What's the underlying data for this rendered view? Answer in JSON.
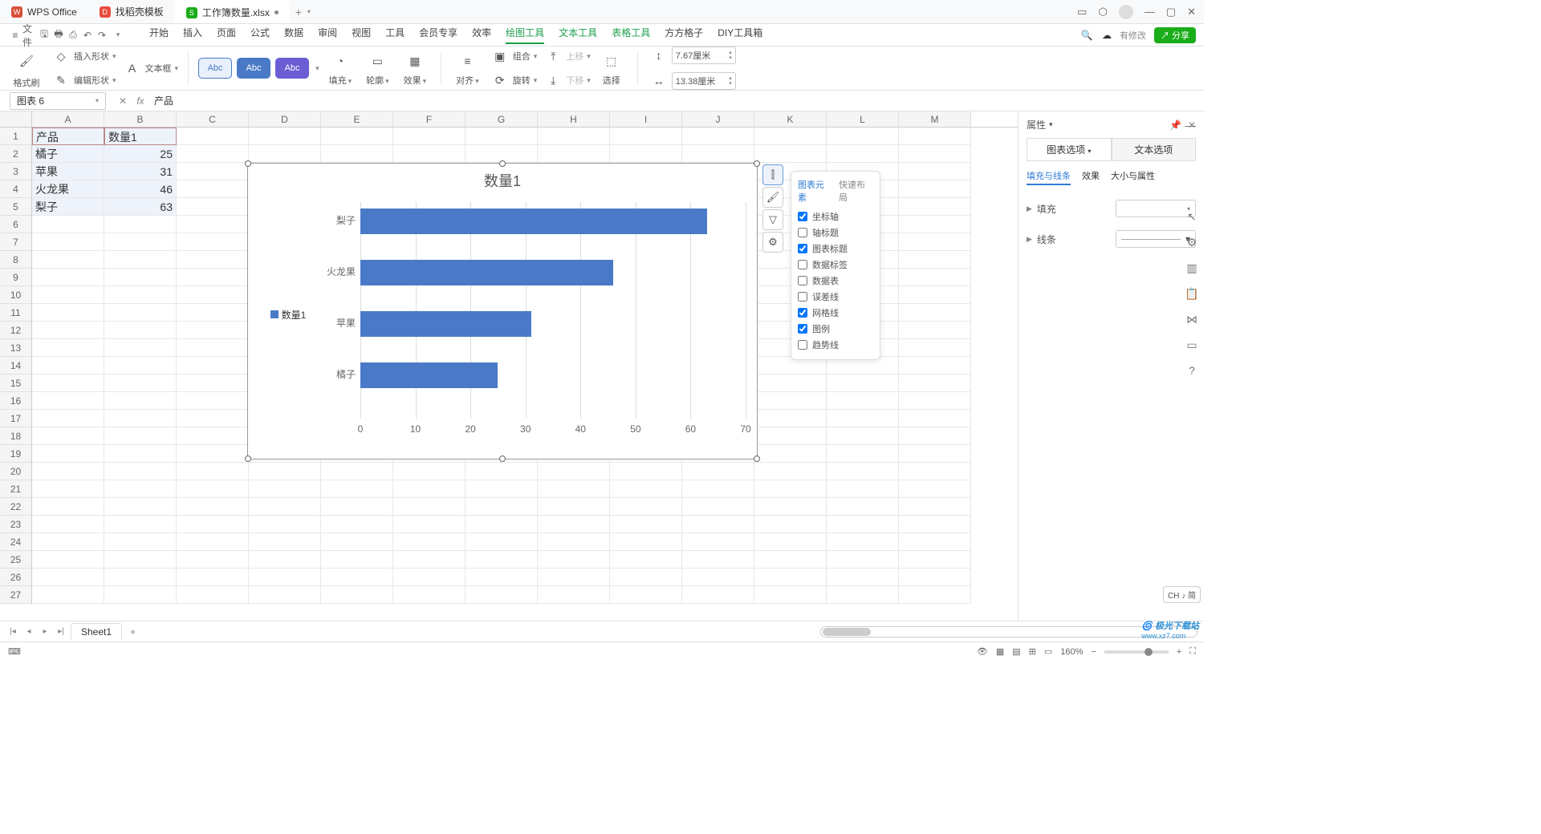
{
  "tabs": {
    "t1": "WPS Office",
    "t2": "找稻壳模板",
    "t3": "工作簿数量.xlsx"
  },
  "titleRight": {
    "modify": "有修改",
    "share": "分享"
  },
  "fileMenu": "文件",
  "menus": [
    "开始",
    "插入",
    "页面",
    "公式",
    "数据",
    "审阅",
    "视图",
    "工具",
    "会员专享",
    "效率",
    "绘图工具",
    "文本工具",
    "表格工具",
    "方方格子",
    "DIY工具箱"
  ],
  "activeMenu": "绘图工具",
  "ribbon": {
    "brush": "格式刷",
    "insShape": "插入形状",
    "editShape": "编辑形状",
    "textbox": "文本框",
    "abc": "Abc",
    "fill": "填充",
    "outline": "轮廓",
    "effect": "效果",
    "align": "对齐",
    "group": "组合",
    "rotate": "旋转",
    "up": "上移",
    "down": "下移",
    "select": "选择",
    "w": "7.67厘米",
    "h": "13.38厘米"
  },
  "namebox": "图表 6",
  "fval": "产品",
  "cols": [
    "A",
    "B",
    "C",
    "D",
    "E",
    "F",
    "G",
    "H",
    "I",
    "J",
    "K",
    "L",
    "M"
  ],
  "cells": {
    "A1": "产品",
    "B1": "数量1",
    "A2": "橘子",
    "B2": "25",
    "A3": "苹果",
    "B3": "31",
    "A4": "火龙果",
    "B4": "46",
    "A5": "梨子",
    "B5": "63"
  },
  "chart": {
    "title": "数量1",
    "legend": "数量1",
    "ylabs": [
      "梨子",
      "火龙果",
      "苹果",
      "橘子"
    ]
  },
  "xticks": [
    "0",
    "10",
    "20",
    "30",
    "40",
    "50",
    "60",
    "70"
  ],
  "popup": {
    "t1": "图表元素",
    "t2": "快速布局",
    "items": [
      {
        "label": "坐标轴",
        "chk": true
      },
      {
        "label": "轴标题",
        "chk": false
      },
      {
        "label": "图表标题",
        "chk": true
      },
      {
        "label": "数据标签",
        "chk": false
      },
      {
        "label": "数据表",
        "chk": false
      },
      {
        "label": "误差线",
        "chk": false
      },
      {
        "label": "网格线",
        "chk": true
      },
      {
        "label": "图例",
        "chk": true
      },
      {
        "label": "趋势线",
        "chk": false
      }
    ]
  },
  "rp": {
    "title": "属性",
    "tab1": "图表选项",
    "tab2": "文本选项",
    "sub1": "填充与线条",
    "sub2": "效果",
    "sub3": "大小与属性",
    "fill": "填充",
    "line": "线条"
  },
  "sheet": "Sheet1",
  "status": {
    "zoom": "160%"
  },
  "ime": "CH ♪ 简",
  "wm1": "极光下载站",
  "wm2": "www.xz7.com",
  "chart_data": {
    "type": "bar",
    "orientation": "horizontal",
    "title": "数量1",
    "categories": [
      "梨子",
      "火龙果",
      "苹果",
      "橘子"
    ],
    "series": [
      {
        "name": "数量1",
        "values": [
          63,
          46,
          31,
          25
        ]
      }
    ],
    "xlabel": "",
    "ylabel": "",
    "xlim": [
      0,
      70
    ],
    "xticks": [
      0,
      10,
      20,
      30,
      40,
      50,
      60,
      70
    ],
    "grid": true,
    "legend_position": "left"
  }
}
